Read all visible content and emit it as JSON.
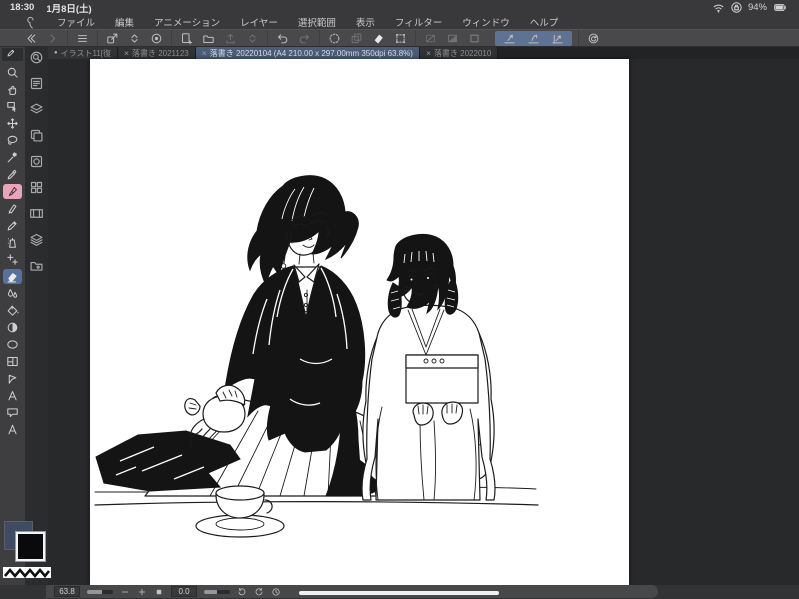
{
  "status_bar": {
    "time": "18:30",
    "date": "1月8日(土)",
    "battery_percent": "94%"
  },
  "menu_bar": {
    "items": [
      "ファイル",
      "編集",
      "アニメーション",
      "レイヤー",
      "選択範囲",
      "表示",
      "フィルター",
      "ウィンドウ",
      "ヘルプ"
    ]
  },
  "command_bar": {
    "groups": [
      {
        "items": [
          {
            "name": "back-chevrons",
            "state": "normal"
          },
          {
            "name": "forward-chevron",
            "state": "disabled"
          }
        ]
      },
      {
        "items": [
          {
            "name": "main-menu",
            "state": "normal"
          }
        ]
      },
      {
        "items": [
          {
            "name": "open-panel",
            "state": "normal"
          },
          {
            "name": "expand-collapse",
            "state": "normal"
          },
          {
            "name": "preview",
            "state": "normal"
          }
        ]
      },
      {
        "items": [
          {
            "name": "new-canvas",
            "state": "normal"
          },
          {
            "name": "open-file",
            "state": "normal"
          },
          {
            "name": "save-export",
            "state": "disabled"
          },
          {
            "name": "expand-collapse-2",
            "state": "disabled"
          }
        ]
      },
      {
        "items": [
          {
            "name": "undo",
            "state": "normal"
          },
          {
            "name": "redo",
            "state": "disabled"
          }
        ]
      },
      {
        "items": [
          {
            "name": "selection-launcher",
            "state": "normal"
          },
          {
            "name": "layer-move",
            "state": "disabled"
          },
          {
            "name": "blend",
            "state": "white"
          },
          {
            "name": "transform",
            "state": "normal"
          }
        ]
      },
      {
        "items": [
          {
            "name": "deselect",
            "state": "disabled"
          },
          {
            "name": "invert-selection",
            "state": "disabled"
          },
          {
            "name": "selection-border",
            "state": "disabled"
          }
        ]
      },
      {
        "style": "snap",
        "items": [
          {
            "name": "snap-ruler",
            "state": "normal"
          },
          {
            "name": "snap-curve",
            "state": "normal"
          },
          {
            "name": "snap-angle",
            "state": "normal"
          }
        ]
      },
      {
        "items": [
          {
            "name": "rotate-reset",
            "state": "normal"
          }
        ]
      }
    ]
  },
  "tab_bar": {
    "close_glyph": "×",
    "modified_glyph": "●",
    "tabs": [
      {
        "label": "イラスト11[復",
        "modified": true
      },
      {
        "label": "落書き 2021123",
        "closable": true
      },
      {
        "label": "落書き 20220104 (A4 210.00 x 297.00mm 350dpi 63.8%)",
        "closable": true,
        "active": true
      },
      {
        "label": "落書き 2022010",
        "closable": true
      }
    ]
  },
  "tool_bar": {
    "tools": [
      {
        "name": "zoom"
      },
      {
        "name": "hand"
      },
      {
        "name": "operate"
      },
      {
        "name": "move"
      },
      {
        "name": "lasso"
      },
      {
        "name": "auto-select"
      },
      {
        "name": "eyedropper"
      },
      {
        "name": "pen",
        "selected": "pink"
      },
      {
        "name": "brush"
      },
      {
        "name": "pencil"
      },
      {
        "name": "airbrush"
      },
      {
        "name": "decoration"
      },
      {
        "name": "eraser",
        "selected": "blue"
      },
      {
        "name": "blend-tool"
      },
      {
        "name": "fill",
        "divider_before": true
      },
      {
        "name": "gradient"
      },
      {
        "name": "figure"
      },
      {
        "name": "frame"
      },
      {
        "name": "line-correct"
      },
      {
        "name": "text"
      },
      {
        "name": "balloon"
      },
      {
        "name": "ruler"
      }
    ]
  },
  "palette_bar": {
    "items": [
      "quick-access",
      "tool-property",
      "sub-tool",
      "brush-shape",
      "navigator",
      "color-set",
      "timeline",
      "layers",
      "materials"
    ]
  },
  "color_swatches": {
    "main_color": "#3f4a63",
    "sub_color": "#0a0a0c"
  },
  "navigation_bar": {
    "zoom_value": "63.8",
    "rotation_value": "0.0"
  },
  "canvas": {
    "paper_color": "#ffffff"
  }
}
